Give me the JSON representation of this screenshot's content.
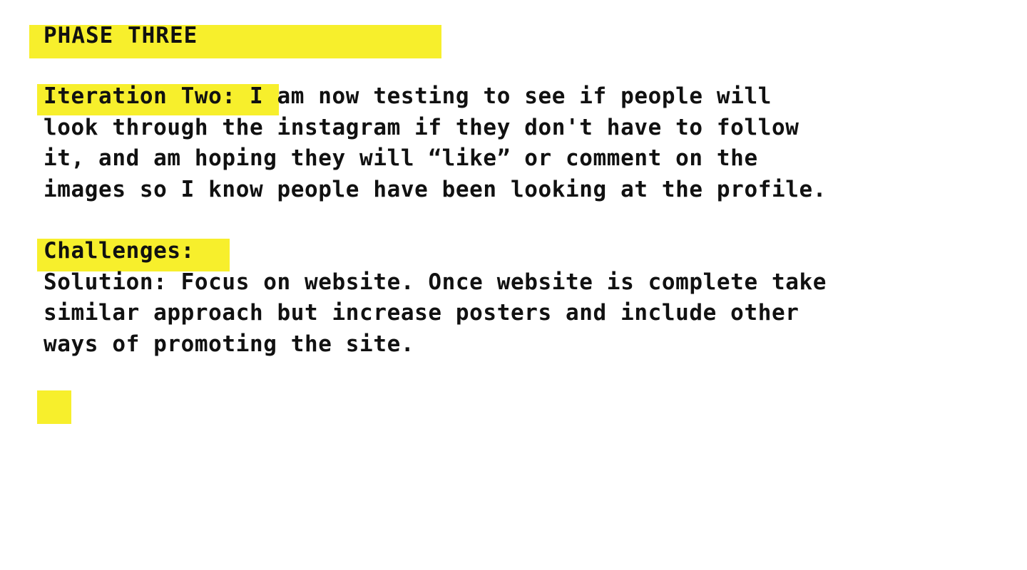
{
  "theme": {
    "highlight_color": "#f7ef2c",
    "text_color": "#111111",
    "background": "#ffffff"
  },
  "phase": {
    "title": "PHASE THREE"
  },
  "iteration": {
    "label": "Iteration Two:",
    "text": " I am now testing to see if people will\nlook through the instagram if they don't have to follow\nit, and am hoping they will “like” or comment on the\nimages so I know people have been looking at the profile."
  },
  "challenges": {
    "label": "Challenges:",
    "text": "\nSolution: Focus on website. Once website is complete take\nsimilar approach but increase posters and include other\nways of promoting the site."
  }
}
